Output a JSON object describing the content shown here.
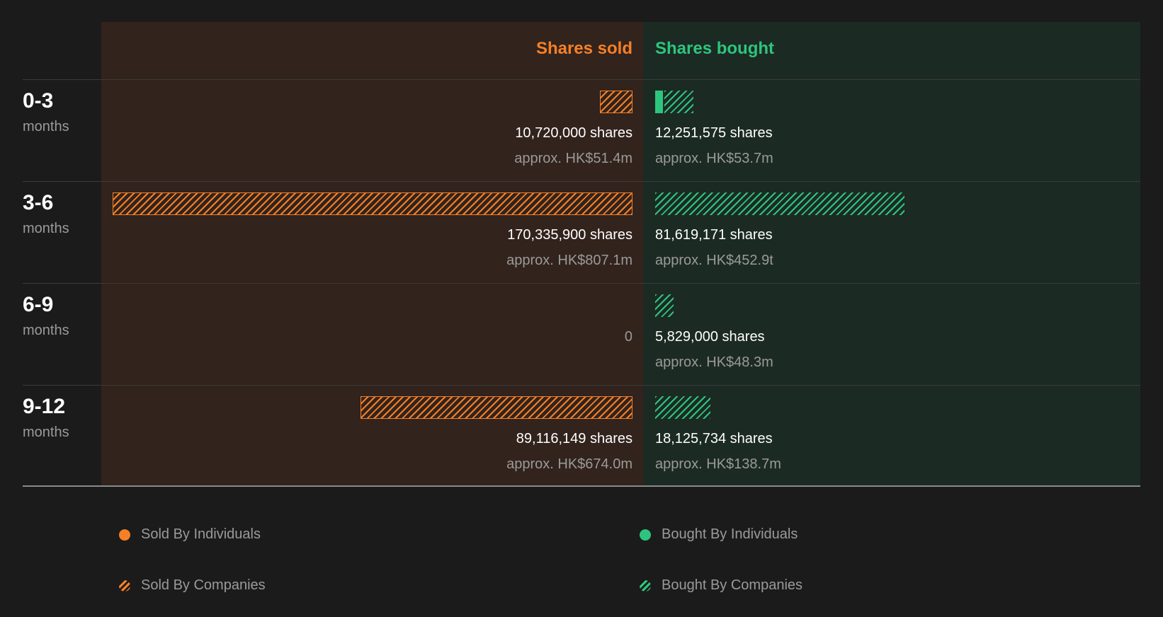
{
  "colors": {
    "sold": "#f58027",
    "bought": "#2dc57e",
    "sold_panel": "#32231c",
    "bought_panel": "#1c2a24",
    "background": "#1b1b1b"
  },
  "headers": {
    "sold": "Shares sold",
    "bought": "Shares bought"
  },
  "legend": {
    "sold_individuals": "Sold By Individuals",
    "bought_individuals": "Bought By Individuals",
    "sold_companies": "Sold By Companies",
    "bought_companies": "Bought By Companies"
  },
  "chart_data": {
    "type": "bar",
    "title": "",
    "categories": [
      "0-3",
      "3-6",
      "6-9",
      "9-12"
    ],
    "category_unit": "months",
    "series": [
      {
        "name": "Shares sold",
        "values": [
          10720000,
          170335900,
          0,
          89116149
        ],
        "individuals_share": [
          0,
          0,
          0,
          0
        ],
        "share_labels": [
          "10,720,000 shares",
          "170,335,900 shares",
          "0",
          "89,116,149 shares"
        ],
        "value_labels": [
          "approx. HK$51.4m",
          "approx. HK$807.1m",
          "",
          "approx. HK$674.0m"
        ]
      },
      {
        "name": "Shares bought",
        "values": [
          12251575,
          81619171,
          5829000,
          18125734
        ],
        "individuals_share": [
          0.2,
          0,
          0,
          0
        ],
        "share_labels": [
          "12,251,575 shares",
          "81,619,171 shares",
          "5,829,000 shares",
          "18,125,734 shares"
        ],
        "value_labels": [
          "approx. HK$53.7m",
          "approx. HK$452.9t",
          "approx. HK$48.3m",
          "approx. HK$138.7m"
        ]
      }
    ],
    "max_value": 170335900
  }
}
